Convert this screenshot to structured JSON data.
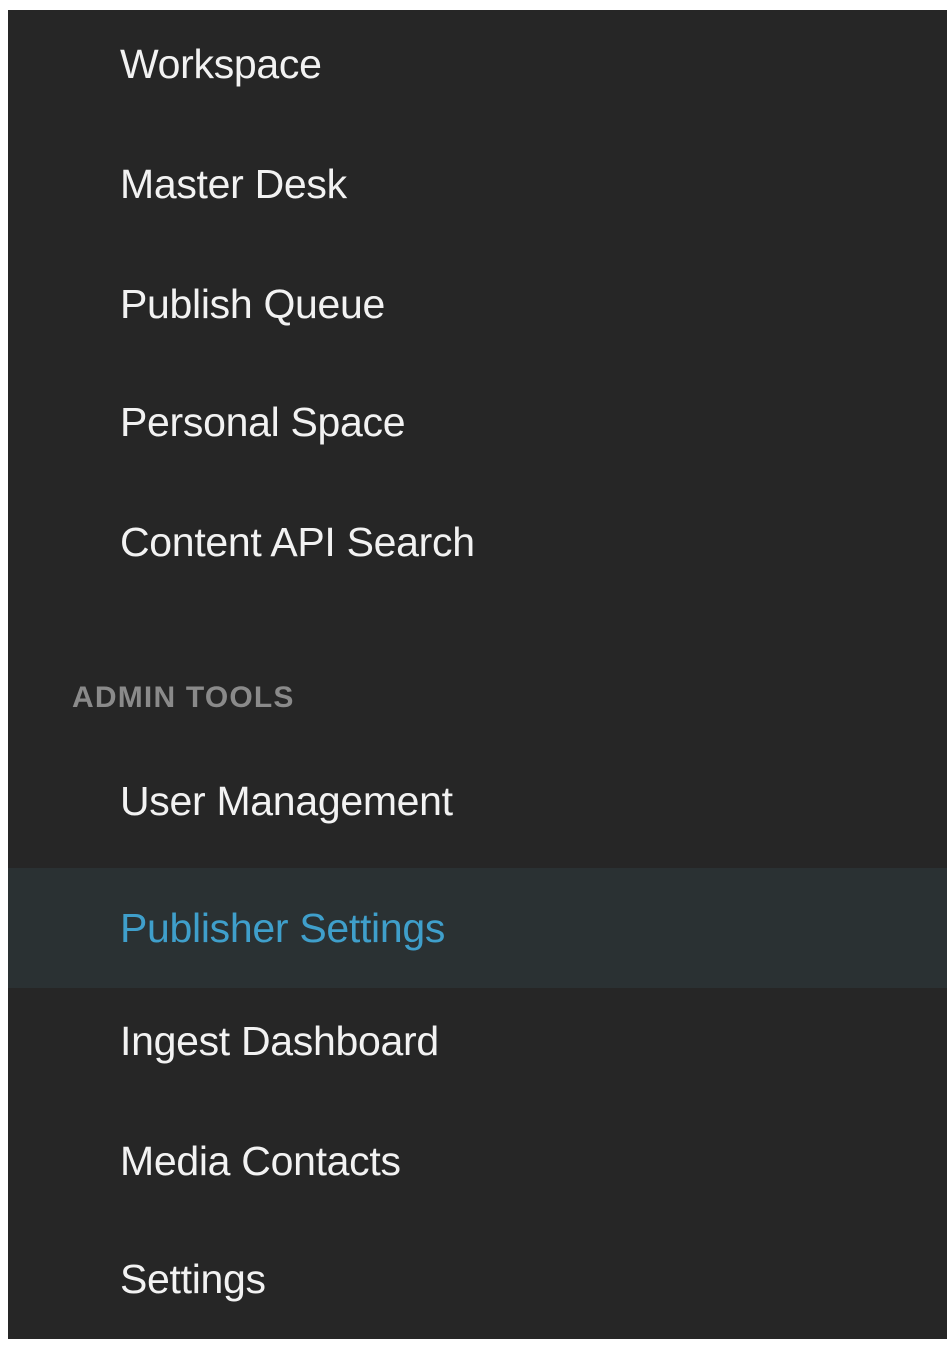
{
  "menu": {
    "items": [
      {
        "label": "Workspace"
      },
      {
        "label": "Master Desk"
      },
      {
        "label": "Publish Queue"
      },
      {
        "label": "Personal Space"
      },
      {
        "label": "Content API Search"
      }
    ]
  },
  "admin_tools": {
    "header": "ADMIN TOOLS",
    "active_item": "Publisher Settings",
    "items": [
      {
        "label": "User Management"
      },
      {
        "label": "Publisher Settings"
      },
      {
        "label": "Ingest Dashboard"
      },
      {
        "label": "Media Contacts"
      },
      {
        "label": "Settings"
      }
    ]
  },
  "colors": {
    "background": "#262626",
    "text": "#f2f2f2",
    "active_text": "#3f9fcb",
    "active_background": "#2a3133",
    "section_header": "#8a8a8a"
  }
}
